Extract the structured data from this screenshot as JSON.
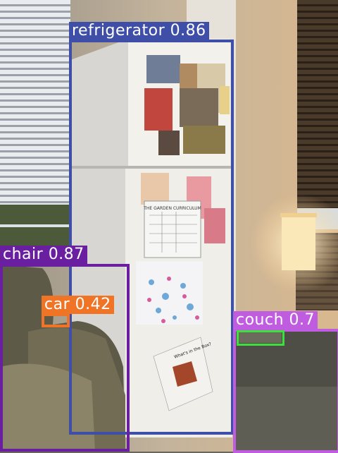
{
  "detections": [
    {
      "class": "refrigerator",
      "score": "0.86",
      "color": "#3f4fa8"
    },
    {
      "class": "chair",
      "score": "0.87",
      "color": "#6a1fa0"
    },
    {
      "class": "car",
      "score": "0.42",
      "color": "#f07426"
    },
    {
      "class": "couch",
      "score": "0.7",
      "color": "#c05ce0"
    },
    {
      "class": "",
      "score": "",
      "color": "#3ee03e"
    }
  ],
  "scene_text": {
    "sign_title": "THE GARDEN CURRICULUM",
    "poster_title": "What's in the Box?"
  }
}
